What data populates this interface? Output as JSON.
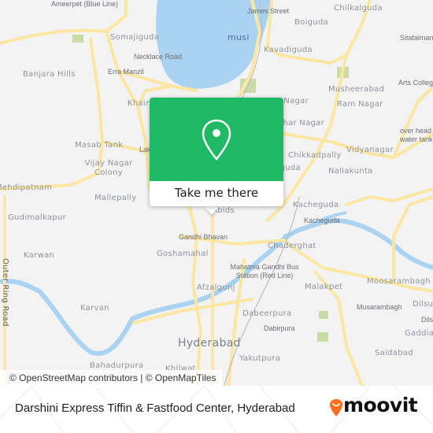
{
  "map": {
    "colors": {
      "land": "#f3f3f4",
      "water": "#aad3f2",
      "road": "#fbe6a2",
      "park": "#c9dca8",
      "accent": "#1fb865",
      "logo_pin": "#ff6d1f"
    },
    "labels": [
      {
        "text": "Ameerpet (Blue Line)",
        "kind": "sm"
      },
      {
        "text": "Somajiguda",
        "kind": "normal"
      },
      {
        "text": "Necklace Road",
        "kind": "sm"
      },
      {
        "text": "Erra Manzil",
        "kind": "sm"
      },
      {
        "text": "Banjara Hills",
        "kind": "normal"
      },
      {
        "text": "Khairatabad",
        "kind": "normal"
      },
      {
        "text": "Masab Tank",
        "kind": "normal"
      },
      {
        "text": "Lakdikapul",
        "kind": "sm"
      },
      {
        "text": "Vijay Nagar Colony",
        "kind": "normal"
      },
      {
        "text": "Mehdipatnam",
        "kind": "normal"
      },
      {
        "text": "Mallepally",
        "kind": "normal"
      },
      {
        "text": "Gudimalkapur",
        "kind": "normal"
      },
      {
        "text": "Karwan",
        "kind": "normal"
      },
      {
        "text": "Outer Ring Road",
        "kind": "sm"
      },
      {
        "text": "Karvan",
        "kind": "normal"
      },
      {
        "text": "Gandhi Bhavan",
        "kind": "sm"
      },
      {
        "text": "Goshamahal",
        "kind": "normal"
      },
      {
        "text": "Afzalgunj",
        "kind": "normal"
      },
      {
        "text": "Hyderabad",
        "kind": "big"
      },
      {
        "text": "Bahadurpura",
        "kind": "normal"
      },
      {
        "text": "Khilwat",
        "kind": "normal"
      },
      {
        "text": "James Street",
        "kind": "sm"
      },
      {
        "text": "Chilkalguda",
        "kind": "normal"
      },
      {
        "text": "Boiguda",
        "kind": "normal"
      },
      {
        "text": "musi",
        "kind": "water"
      },
      {
        "text": "Sitafalmandi",
        "kind": "sm"
      },
      {
        "text": "Kavadiguda",
        "kind": "normal"
      },
      {
        "text": "Musheerabad",
        "kind": "normal"
      },
      {
        "text": "Arts College",
        "kind": "sm"
      },
      {
        "text": "Ram Nagar",
        "kind": "normal"
      },
      {
        "text": "Ashok Nagar",
        "kind": "normal"
      },
      {
        "text": "Jawahar Nagar",
        "kind": "normal"
      },
      {
        "text": "over head water tank",
        "kind": "sm"
      },
      {
        "text": "Chikkadpally",
        "kind": "normal"
      },
      {
        "text": "Vidyanagar",
        "kind": "normal"
      },
      {
        "text": "Narayanguda",
        "kind": "normal"
      },
      {
        "text": "Nallakunta",
        "kind": "normal"
      },
      {
        "text": "Kacheguda",
        "kind": "normal"
      },
      {
        "text": "Kacheguda",
        "kind": "sm"
      },
      {
        "text": "Abids",
        "kind": "normal"
      },
      {
        "text": "Chaderghat",
        "kind": "normal"
      },
      {
        "text": "Mahatma Gandhi Bus Station (Red Line)",
        "kind": "sm"
      },
      {
        "text": "Malakpet",
        "kind": "normal"
      },
      {
        "text": "Moosarambagh",
        "kind": "normal"
      },
      {
        "text": "Musarambagh",
        "kind": "sm"
      },
      {
        "text": "Dilsukhnagar",
        "kind": "normal"
      },
      {
        "text": "Dilsukhnagar",
        "kind": "sm"
      },
      {
        "text": "Dabeerpura",
        "kind": "normal"
      },
      {
        "text": "Dabirpura",
        "kind": "sm"
      },
      {
        "text": "Gaddiannaram",
        "kind": "normal"
      },
      {
        "text": "Saidabad",
        "kind": "normal"
      },
      {
        "text": "Yakutpura",
        "kind": "normal"
      }
    ],
    "attribution": "© OpenStreetMap contributors | © OpenMapTiles"
  },
  "popup": {
    "icon": "map-pin-icon",
    "button_label": "Take me there"
  },
  "footer": {
    "title": "Darshini Express Tiffin & Fastfood Center, Hyderabad",
    "logo_text": "moovit"
  }
}
